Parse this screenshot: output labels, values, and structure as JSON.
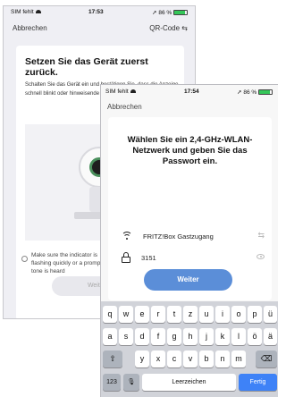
{
  "screen1": {
    "status": {
      "carrier": "SIM fehlt",
      "time": "17:53",
      "battery": "86 %",
      "battery_level": 0.86
    },
    "nav": {
      "back_label": "Abbrechen",
      "qr_label": "QR-Code ⇆"
    },
    "heading": "Setzen Sie das Gerät zuerst zurück.",
    "body": "Schalten Sie das Gerät ein und bestätigen Sie, dass die Anzeige schnell blinkt oder hinweisende Töne hören.",
    "checkbox_label": "Make sure the indicator is flashing quickly or a prompt tone is heard",
    "button_label": "Weiter"
  },
  "screen2": {
    "status": {
      "carrier": "SIM fehlt",
      "time": "17:54",
      "battery": "86 %",
      "battery_level": 0.86
    },
    "nav": {
      "back_label": "Abbrechen"
    },
    "heading": "Wählen Sie ein 2,4-GHz-WLAN-Netzwerk und geben Sie das Passwort ein.",
    "network": {
      "value": "FRITZ!Box Gastzugang",
      "end_icon": "switch-icon"
    },
    "password": {
      "value": "3151",
      "end_icon": "eye-icon"
    },
    "button_label": "Weiter"
  },
  "keyboard": {
    "row1": [
      "q",
      "w",
      "e",
      "r",
      "t",
      "z",
      "u",
      "i",
      "o",
      "p",
      "ü"
    ],
    "row2": [
      "a",
      "s",
      "d",
      "f",
      "g",
      "h",
      "j",
      "k",
      "l",
      "ö",
      "ä"
    ],
    "row3": [
      "y",
      "x",
      "c",
      "v",
      "b",
      "n",
      "m"
    ],
    "numbers_label": "123",
    "space_label": "Leerzeichen",
    "done_label": "Fertig",
    "shift_symbol": "⇧",
    "delete_symbol": "⌫",
    "mic_symbol": "🎙"
  },
  "colors": {
    "accent": "#5b8ed8",
    "done_key": "#3e82f7",
    "battery": "#35c759"
  }
}
